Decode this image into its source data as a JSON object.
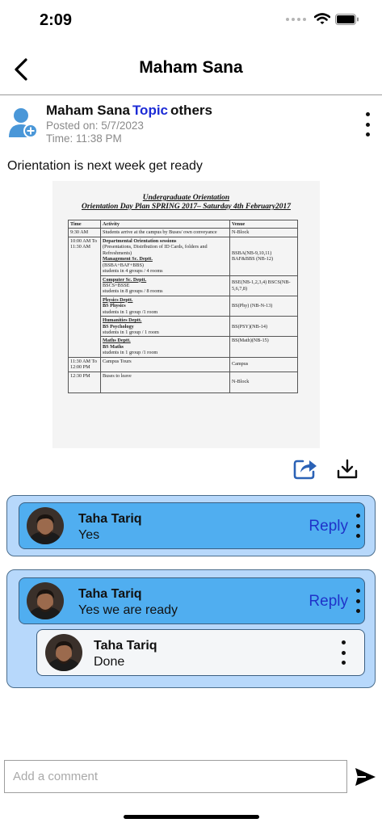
{
  "status_bar": {
    "time": "2:09",
    "icons": [
      "signal-dots-icon",
      "wifi-icon",
      "battery-icon"
    ]
  },
  "nav": {
    "title": "Maham Sana",
    "back_icon": "chevron-left-icon"
  },
  "post": {
    "author": "Maham Sana",
    "topic_label": "Topic",
    "audience": "others",
    "posted_on": "Posted on: 5/7/2023",
    "time": "Time: 11:38 PM",
    "text": "Orientation is next week get ready"
  },
  "attachment": {
    "title": "Undergraduate Orientation",
    "subtitle": "Orientation Day Plan SPRING 2017– Saturday 4th February2017",
    "headers": [
      "Time",
      "Activity",
      "Venue"
    ],
    "row1": {
      "time": "9:30 AM",
      "activity": "Students arrive at the campus by Buses/ own conveyance",
      "venue": "N-Block"
    },
    "row2": {
      "time": "10:00 AM To 11:30 AM",
      "activity_title": "Departmental Orientation sessions",
      "activity_detail": "(Presentations, Distribution of ID Cards, folders and Refreshments)",
      "dept1_name": "Management Sc. Deptt.",
      "dept1_programs": "(BSBA+BAF+BBS)",
      "dept1_groups": "students in 4 groups / 4 rooms",
      "dept1_venue": "BSBA(NB-9,10,11) BAF&BBS (NB-12)",
      "dept2_name": "Computer Sc. Deptt.",
      "dept2_programs": "BSCS+BSSE",
      "dept2_groups": "students in 8 groups / 8 rooms",
      "dept2_venue": "BSE(NB-1,2,3,4) BSCS(NB-5,6,7,8)",
      "dept3_name": "Physics Deptt.",
      "dept3_programs": "BS Physics",
      "dept3_groups": "students in 1 group /1 room",
      "dept3_venue": "BS(Phy) (NB-N-13)",
      "dept4_name": "Humanities Deptt.",
      "dept4_programs": "BS Psychology",
      "dept4_groups": "students in 1 group / 1 room",
      "dept4_venue": "BS(PSY)(NB-14)",
      "dept5_name": "Maths Deptt.",
      "dept5_programs": "BS Maths",
      "dept5_groups": "students in 1 group /1 room",
      "dept5_venue": "BS(Math)(NB-15)"
    },
    "row3": {
      "time": "11:30 AM To 12:00 PM",
      "activity": "Campus Tours",
      "venue": "Campus"
    },
    "row4": {
      "time": "12:30 PM",
      "activity": "Buses to leave",
      "venue": "N-Block"
    }
  },
  "actions": {
    "share_icon": "share-icon",
    "download_icon": "download-icon"
  },
  "comments": [
    {
      "name": "Taha Tariq",
      "text": "Yes",
      "reply_label": "Reply"
    },
    {
      "name": "Taha Tariq",
      "text": "Yes we are ready",
      "reply_label": "Reply",
      "replies": [
        {
          "name": "Taha Tariq",
          "text": "Done"
        }
      ]
    }
  ],
  "composer": {
    "placeholder": "Add a comment",
    "send_icon": "send-icon"
  },
  "colors": {
    "primary_comment": "#50aef0",
    "comment_group": "#b7d8fb",
    "reply_link": "#1f33c9",
    "topic": "#1c2bd6"
  }
}
